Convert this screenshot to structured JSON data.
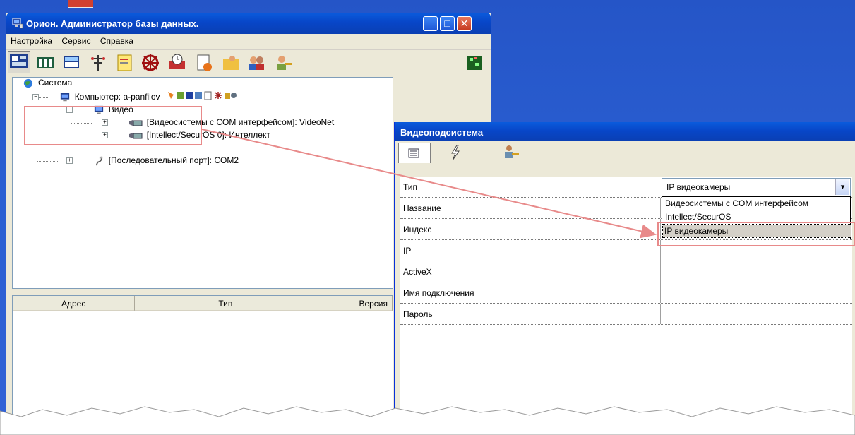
{
  "main_window": {
    "title": "Орион. Администратор базы данных.",
    "controls": {
      "minimize": "_",
      "maximize": "□",
      "close": "✕"
    },
    "menu": [
      "Настройка",
      "Сервис",
      "Справка"
    ],
    "toolbar_icons": [
      "system-tree-icon",
      "devices-icon",
      "computer-window-icon",
      "network-icon",
      "sticky-note-icon",
      "wheel-icon",
      "train-clock-icon",
      "document-icon",
      "folder-user-icon",
      "users-icon",
      "user-key-icon",
      "green-grid-icon"
    ],
    "tree": {
      "root": "Система",
      "computer": "Компьютер: a-panfilov",
      "video": "Видео",
      "children": [
        "[Видеосистемы с COM интерфейсом]: VideoNet",
        "[Intellect/SecurOS 0]: Интеллект"
      ],
      "serial": "[Последовательный порт]: COM2"
    },
    "table": {
      "columns": [
        "Адрес",
        "Тип",
        "Версия"
      ]
    }
  },
  "properties_window": {
    "title": "Видеоподсистема",
    "tabs": [
      "list-icon",
      "lightning-icon",
      "users-key-icon"
    ],
    "properties": [
      {
        "name": "Тип",
        "value": "IP видеокамеры"
      },
      {
        "name": "Название",
        "value": ""
      },
      {
        "name": "Индекс",
        "value": ""
      },
      {
        "name": "IP",
        "value": ""
      },
      {
        "name": "ActiveX",
        "value": ""
      },
      {
        "name": "Имя подключения",
        "value": ""
      },
      {
        "name": "Пароль",
        "value": ""
      }
    ],
    "dropdown_options": [
      "Видеосистемы с COM интерфейсом",
      "Intellect/SecurOS",
      "IP видеокамеры"
    ],
    "dropdown_selected": "IP видеокамеры"
  },
  "colors": {
    "title_bar": "#0846c8",
    "window_face": "#ece9d8",
    "highlight_annotation": "#e88a8a",
    "desktop": "#2a5fd2"
  }
}
